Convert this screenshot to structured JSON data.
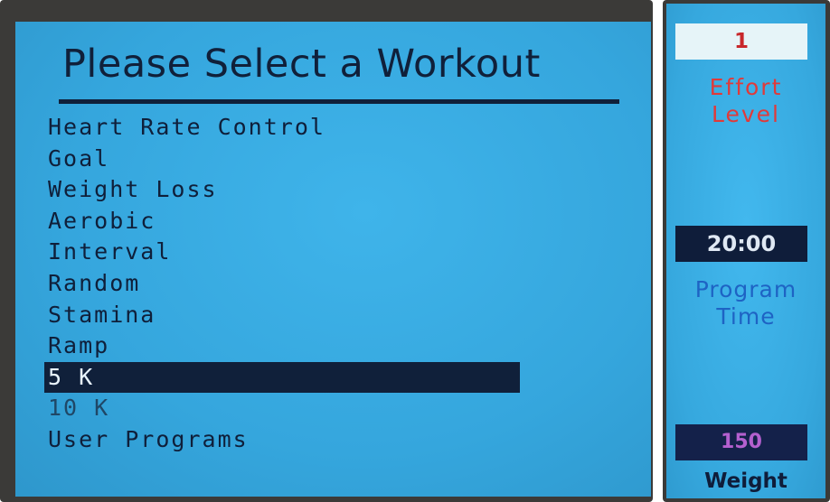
{
  "main": {
    "title": "Please Select a Workout",
    "items": [
      {
        "label": "Heart Rate Control",
        "selected": false
      },
      {
        "label": "Goal",
        "selected": false
      },
      {
        "label": "Weight Loss",
        "selected": false
      },
      {
        "label": "Aerobic",
        "selected": false
      },
      {
        "label": "Interval",
        "selected": false
      },
      {
        "label": "Random",
        "selected": false
      },
      {
        "label": "Stamina",
        "selected": false
      },
      {
        "label": "Ramp",
        "selected": false
      },
      {
        "label": "5 K",
        "selected": true
      },
      {
        "label": "10 K",
        "selected": false
      },
      {
        "label": "User Programs",
        "selected": false
      }
    ]
  },
  "side": {
    "effort": {
      "value": "1",
      "label_line1": "Effort",
      "label_line2": "Level"
    },
    "time": {
      "value": "20:00",
      "label_line1": "Program",
      "label_line2": "Time"
    },
    "weight": {
      "value": "150",
      "label": "Weight"
    }
  },
  "colors": {
    "screen_bg": "#35a6dd",
    "text_dark": "#10203a",
    "selection_bg": "#10203a",
    "effort_red": "#e03a3a",
    "time_blue": "#1e63c4",
    "weight_purple": "#b460cf"
  }
}
